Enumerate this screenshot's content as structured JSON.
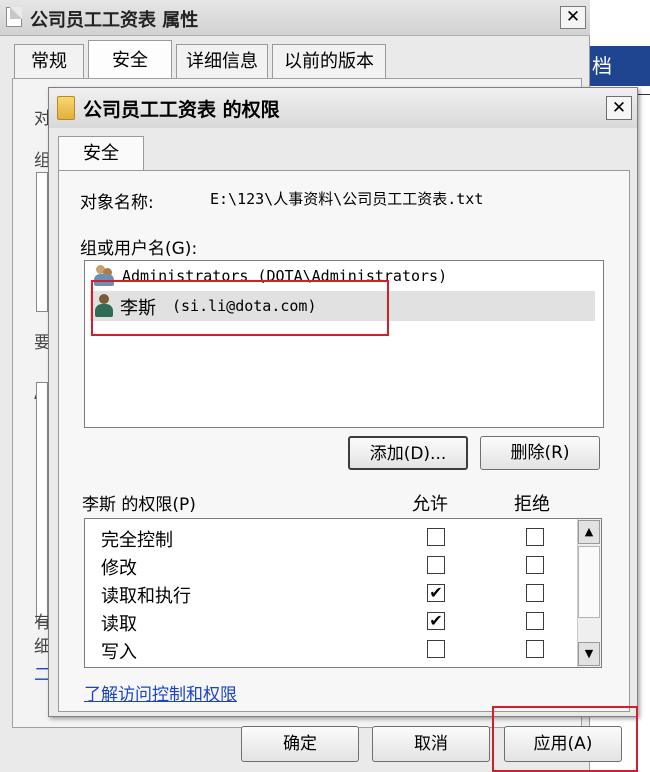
{
  "outer_window": {
    "title": "公司员工工资表 属性",
    "close": "✕",
    "tabs": [
      {
        "label": "常规"
      },
      {
        "label": "安全"
      },
      {
        "label": "详细信息"
      },
      {
        "label": "以前的版本"
      }
    ],
    "partial_labels": [
      "对",
      "组",
      "要",
      "A",
      "有",
      "细",
      "二"
    ]
  },
  "background_window": {
    "title_fragment": "档"
  },
  "dialog": {
    "title": "公司员工工资表 的权限",
    "close": "✕",
    "tab": "安全",
    "object_name_label": "对象名称:",
    "object_name_value": "E:\\123\\人事资料\\公司员工工资表.txt",
    "group_label": "组或用户名(G):",
    "users": [
      {
        "name": "Administrators (DOTA\\Administrators)",
        "icon": "group-icon"
      },
      {
        "name": "李斯",
        "email": "(si.li@dota.com)",
        "icon": "user-icon",
        "selected": true
      }
    ],
    "add_button": "添加(D)...",
    "remove_button": "删除(R)",
    "permissions_label": "李斯 的权限(P)",
    "allow_header": "允许",
    "deny_header": "拒绝",
    "permissions": [
      {
        "name": "完全控制",
        "allow": false,
        "deny": false
      },
      {
        "name": "修改",
        "allow": false,
        "deny": false
      },
      {
        "name": "读取和执行",
        "allow": true,
        "deny": false
      },
      {
        "name": "读取",
        "allow": true,
        "deny": false
      },
      {
        "name": "写入",
        "allow": false,
        "deny": false
      }
    ],
    "check_mark": "✔",
    "scroll_up": "▲",
    "scroll_down": "▼",
    "learn_link": "了解访问控制和权限"
  },
  "footer": {
    "ok": "确定",
    "cancel": "取消",
    "apply": "应用(A)"
  },
  "colors": {
    "highlight_red": "#d21f2b",
    "link_blue": "#1a43c9",
    "bg_titlebar_blue": "#1f4591"
  }
}
